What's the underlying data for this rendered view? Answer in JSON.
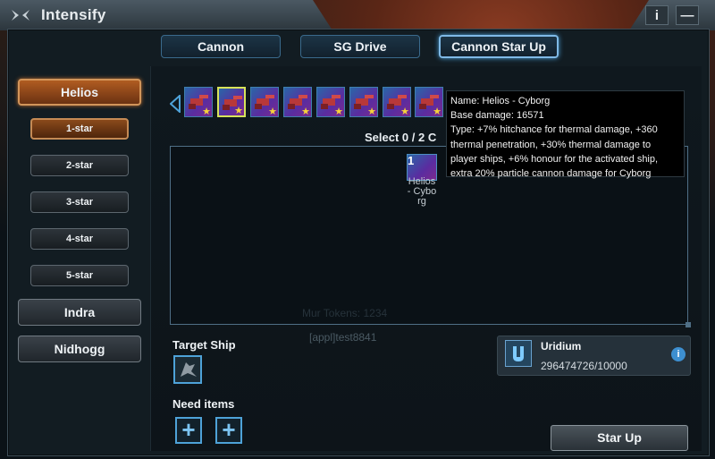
{
  "window": {
    "title": "Intensify",
    "info_btn": "i",
    "minimize_btn": "—"
  },
  "tabs": [
    {
      "label": "Cannon",
      "active": false
    },
    {
      "label": "SG Drive",
      "active": false
    },
    {
      "label": "Cannon Star Up",
      "active": true
    }
  ],
  "nav": {
    "groups": [
      {
        "label": "Helios",
        "active": true
      },
      {
        "label": "Indra",
        "active": false
      },
      {
        "label": "Nidhogg",
        "active": false
      }
    ],
    "stars": [
      {
        "label": "1-star",
        "active": true
      },
      {
        "label": "2-star",
        "active": false
      },
      {
        "label": "3-star",
        "active": false
      },
      {
        "label": "4-star",
        "active": false
      },
      {
        "label": "5-star",
        "active": false
      }
    ]
  },
  "select": {
    "text": "Select 0 / 2 C"
  },
  "card": {
    "count": "1",
    "name": "Helios - Cyborg"
  },
  "tooltip": {
    "name": "Name: Helios - Cyborg",
    "damage": "Base damage: 16571",
    "type": "Type: +7% hitchance for thermal damage, +360 thermal penetration, +30% thermal damage to player ships, +6% honour for the activated ship, extra 20% particle cannon damage for Cyborg"
  },
  "bg_text": {
    "player": "[appl]test8841",
    "faded": "Mur Tokens: 1234"
  },
  "target": {
    "label": "Target Ship"
  },
  "need": {
    "label": "Need items",
    "plus": "+"
  },
  "resource": {
    "name": "Uridium",
    "value": "296474726/10000",
    "info": "i"
  },
  "actions": {
    "star_up": "Star Up"
  },
  "colors": {
    "accent_blue": "#4ea2d8",
    "active_orange": "#b05c21",
    "star_gold": "#f7d13a"
  }
}
